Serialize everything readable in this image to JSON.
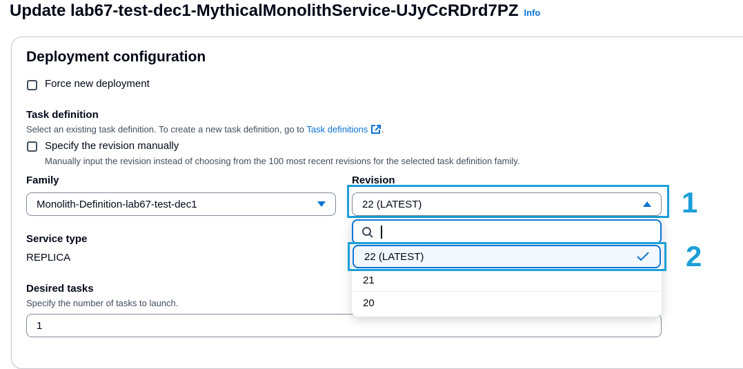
{
  "header": {
    "title": "Update lab67-test-dec1-MythicalMonolithService-UJyCcRDrd7PZ",
    "info": "Info"
  },
  "deployment": {
    "title": "Deployment configuration",
    "force_new_deployment": "Force new deployment",
    "task_definition": {
      "label": "Task definition",
      "description_prefix": "Select an existing task definition. To create a new task definition, go to",
      "link": "Task definitions",
      "description_suffix": "."
    },
    "specify_revision": {
      "label": "Specify the revision manually",
      "description": "Manually input the revision instead of choosing from the 100 most recent revisions for the selected task definition family."
    },
    "family": {
      "label": "Family",
      "value": "Monolith-Definition-lab67-test-dec1"
    },
    "revision": {
      "label": "Revision",
      "value": "22 (LATEST)",
      "search_placeholder": "",
      "options": [
        "22 (LATEST)",
        "21",
        "20"
      ]
    },
    "service_type": {
      "label": "Service type",
      "value": "REPLICA"
    },
    "desired_tasks": {
      "label": "Desired tasks",
      "description": "Specify the number of tasks to launch.",
      "value": "1"
    }
  },
  "callouts": {
    "one": "1",
    "two": "2"
  },
  "colors": {
    "accent": "#0972d3",
    "highlight": "#1a9fd8",
    "text": "#000716"
  }
}
